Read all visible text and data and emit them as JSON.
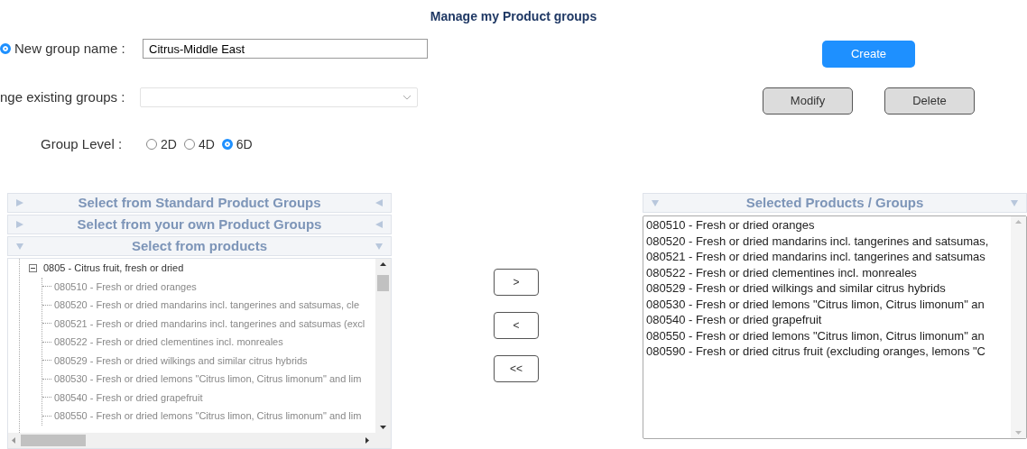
{
  "title": "Manage my Product groups",
  "new_group": {
    "selected": true,
    "label": "New group name :",
    "value": "Citrus-Middle East"
  },
  "existing_groups": {
    "label": "nge existing groups :",
    "disabled": true
  },
  "group_level": {
    "label": "Group Level :",
    "options": [
      {
        "label": "2D",
        "selected": false
      },
      {
        "label": "4D",
        "selected": false
      },
      {
        "label": "6D",
        "selected": true
      }
    ]
  },
  "actions": [
    {
      "label": "Create",
      "kind": "primary"
    },
    {
      "label": "Modify",
      "kind": "secondary"
    },
    {
      "label": "Delete",
      "kind": "secondary"
    }
  ],
  "sections": [
    {
      "title": "Select from Standard Product Groups",
      "expanded": false
    },
    {
      "title": "Select from your own Product Groups",
      "expanded": false
    },
    {
      "title": "Select from products",
      "expanded": true
    }
  ],
  "tree": [
    {
      "label": "0805 - Citrus fruit, fresh or dried",
      "expanded": true,
      "children": [
        {
          "label": "080510 - Fresh or dried oranges"
        },
        {
          "label": "080520 - Fresh or dried mandarins incl. tangerines and satsumas, cle"
        },
        {
          "label": "080521 - Fresh or dried mandarins incl. tangerines and satsumas (excl"
        },
        {
          "label": "080522 - Fresh or dried clementines incl. monreales"
        },
        {
          "label": "080529 - Fresh or dried wilkings and similar citrus hybrids"
        },
        {
          "label": "080530 - Fresh or dried lemons \"Citrus limon, Citrus limonum\" and lim"
        },
        {
          "label": "080540 - Fresh or dried grapefruit"
        },
        {
          "label": "080550 - Fresh or dried lemons \"Citrus limon, Citrus limonum\" and lim"
        }
      ]
    }
  ],
  "move_buttons": [
    ">",
    "<",
    "<<"
  ],
  "selected_panel": {
    "title": "Selected Products / Groups",
    "expanded": true,
    "items": [
      "080510 - Fresh or dried oranges",
      "080520 - Fresh or dried mandarins incl. tangerines and satsumas,",
      "080521 - Fresh or dried mandarins incl. tangerines and satsumas",
      "080522 - Fresh or dried clementines incl. monreales",
      "080529 - Fresh or dried wilkings and similar citrus hybrids",
      "080530 - Fresh or dried lemons \"Citrus limon, Citrus limonum\" an",
      "080540 - Fresh or dried grapefruit",
      "080550 - Fresh or dried lemons \"Citrus limon, Citrus limonum\" an",
      "080590 - Fresh or dried citrus fruit (excluding oranges, lemons \"C"
    ]
  }
}
